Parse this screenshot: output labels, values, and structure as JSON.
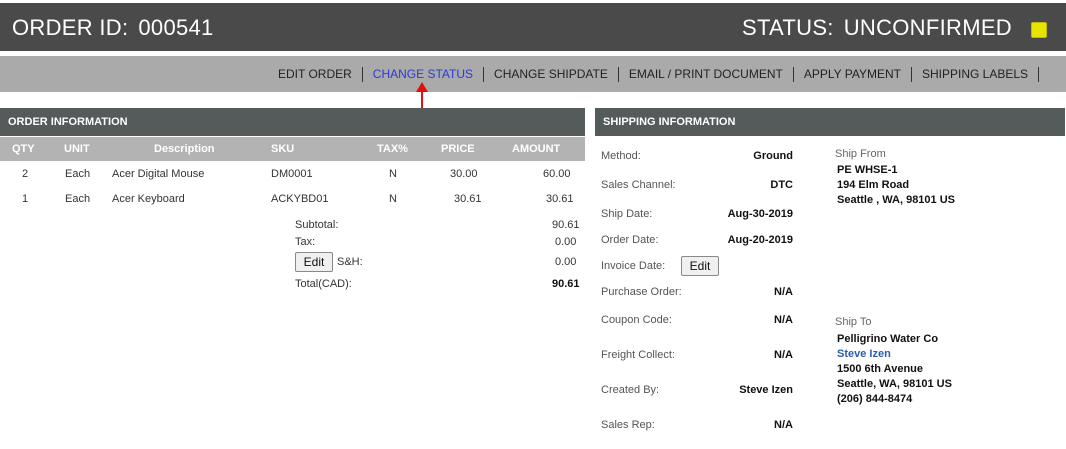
{
  "header": {
    "order_label": "ORDER ID:",
    "order_id": "000541",
    "status_label": "STATUS:",
    "status": "UNCONFIRMED",
    "status_color": "#e6e600"
  },
  "actions": [
    {
      "label": "EDIT ORDER"
    },
    {
      "label": "CHANGE STATUS",
      "active": true
    },
    {
      "label": "CHANGE SHIPDATE"
    },
    {
      "label": "EMAIL / PRINT DOCUMENT"
    },
    {
      "label": "APPLY PAYMENT"
    },
    {
      "label": "SHIPPING LABELS"
    }
  ],
  "order_info": {
    "title": "ORDER INFORMATION",
    "columns": [
      "QTY",
      "UNIT",
      "Description",
      "SKU",
      "TAX%",
      "PRICE",
      "AMOUNT"
    ],
    "rows": [
      {
        "qty": "2",
        "unit": "Each",
        "description": "Acer Digital Mouse",
        "sku": "DM0001",
        "tax": "N",
        "price": "30.00",
        "amount": "60.00"
      },
      {
        "qty": "1",
        "unit": "Each",
        "description": "Acer Keyboard",
        "sku": "ACKYBD01",
        "tax": "N",
        "price": "30.61",
        "amount": "30.61"
      }
    ],
    "totals": {
      "subtotal_label": "Subtotal:",
      "subtotal": "90.61",
      "tax_label": "Tax:",
      "tax": "0.00",
      "edit_label": "Edit",
      "sh_label": "S&H:",
      "sh": "0.00",
      "total_label": "Total(CAD):",
      "total": "90.61"
    }
  },
  "shipping_info": {
    "title": "SHIPPING INFORMATION",
    "fields": [
      {
        "label": "Method:",
        "value": "Ground"
      },
      {
        "label": "Sales Channel:",
        "value": "DTC"
      },
      {
        "label": "Ship Date:",
        "value": "Aug-30-2019"
      },
      {
        "label": "Order Date:",
        "value": "Aug-20-2019"
      },
      {
        "label": "Invoice Date:",
        "button": "Edit"
      },
      {
        "label": "Purchase Order:",
        "value": "N/A"
      },
      {
        "label": "Coupon Code:",
        "value": "N/A"
      },
      {
        "label": "Freight Collect:",
        "value": "N/A"
      },
      {
        "label": "Created By:",
        "value": "Steve Izen"
      },
      {
        "label": "Sales Rep:",
        "value": "N/A"
      }
    ],
    "ship_from": {
      "label": "Ship From",
      "lines": [
        "PE WHSE-1",
        "194 Elm Road",
        "Seattle , WA, 98101 US"
      ]
    },
    "ship_to": {
      "label": "Ship To",
      "company": "Pelligrino Water Co",
      "contact": "Steve Izen",
      "lines": [
        "1500 6th Avenue",
        "Seattle, WA, 98101 US",
        "(206) 844-8474"
      ]
    }
  }
}
